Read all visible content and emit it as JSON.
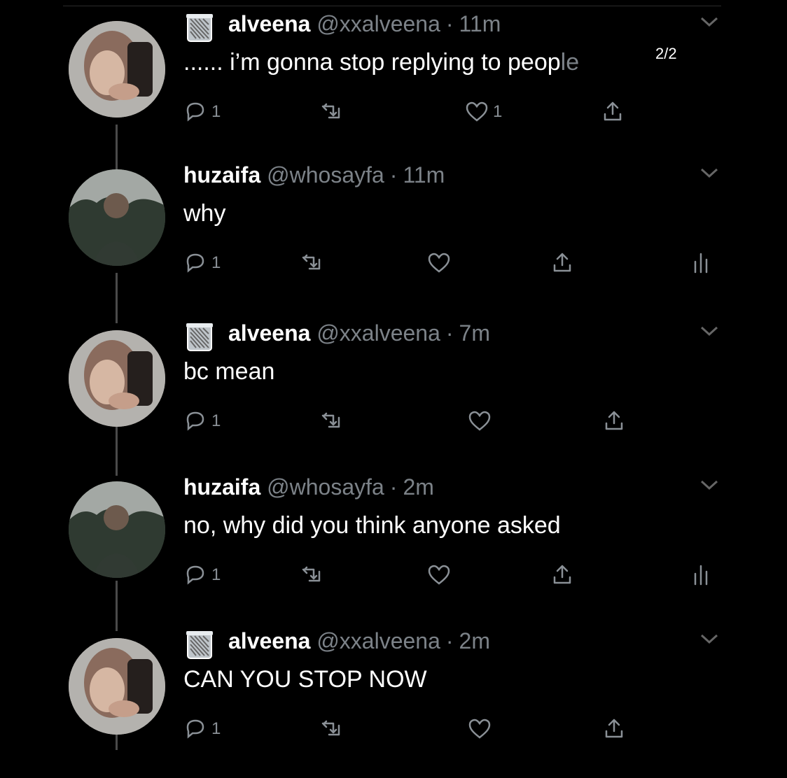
{
  "thread": [
    {
      "author": "alveena",
      "handle": "@xxalveena",
      "time": "11m",
      "text": "...... i’m gonna stop replying to peop",
      "fade_text": "le",
      "thread_count": "2/2",
      "trash_emoji": true,
      "avatar": "selfie-avatar",
      "replies": "1",
      "retweets": "",
      "likes": "1",
      "show_analytics": false
    },
    {
      "author": "huzaifa",
      "handle": "@whosayfa",
      "time": "11m",
      "text": "why",
      "trash_emoji": false,
      "avatar": "outdoor-avatar",
      "replies": "1",
      "retweets": "",
      "likes": "",
      "show_analytics": true
    },
    {
      "author": "alveena",
      "handle": "@xxalveena",
      "time": "7m",
      "text": "bc mean",
      "trash_emoji": true,
      "avatar": "selfie-avatar",
      "replies": "1",
      "retweets": "",
      "likes": "",
      "show_analytics": false
    },
    {
      "author": "huzaifa",
      "handle": "@whosayfa",
      "time": "2m",
      "text": "no, why did you think anyone asked",
      "trash_emoji": false,
      "avatar": "outdoor-avatar",
      "replies": "1",
      "retweets": "",
      "likes": "",
      "show_analytics": true
    },
    {
      "author": "alveena",
      "handle": "@xxalveena",
      "time": "2m",
      "text": "CAN YOU STOP NOW",
      "trash_emoji": true,
      "avatar": "selfie-avatar",
      "replies": "1",
      "retweets": "",
      "likes": "",
      "show_analytics": false
    }
  ],
  "icons": {
    "reply": "reply-icon",
    "retweet": "retweet-icon",
    "like": "heart-icon",
    "share": "share-icon",
    "analytics": "analytics-icon",
    "menu": "chevron-down-icon",
    "trash": "wastebasket-emoji-icon"
  },
  "colors": {
    "background": "#000000",
    "name": "#ffffff",
    "meta": "#7c8288",
    "icon": "#8a9096"
  }
}
